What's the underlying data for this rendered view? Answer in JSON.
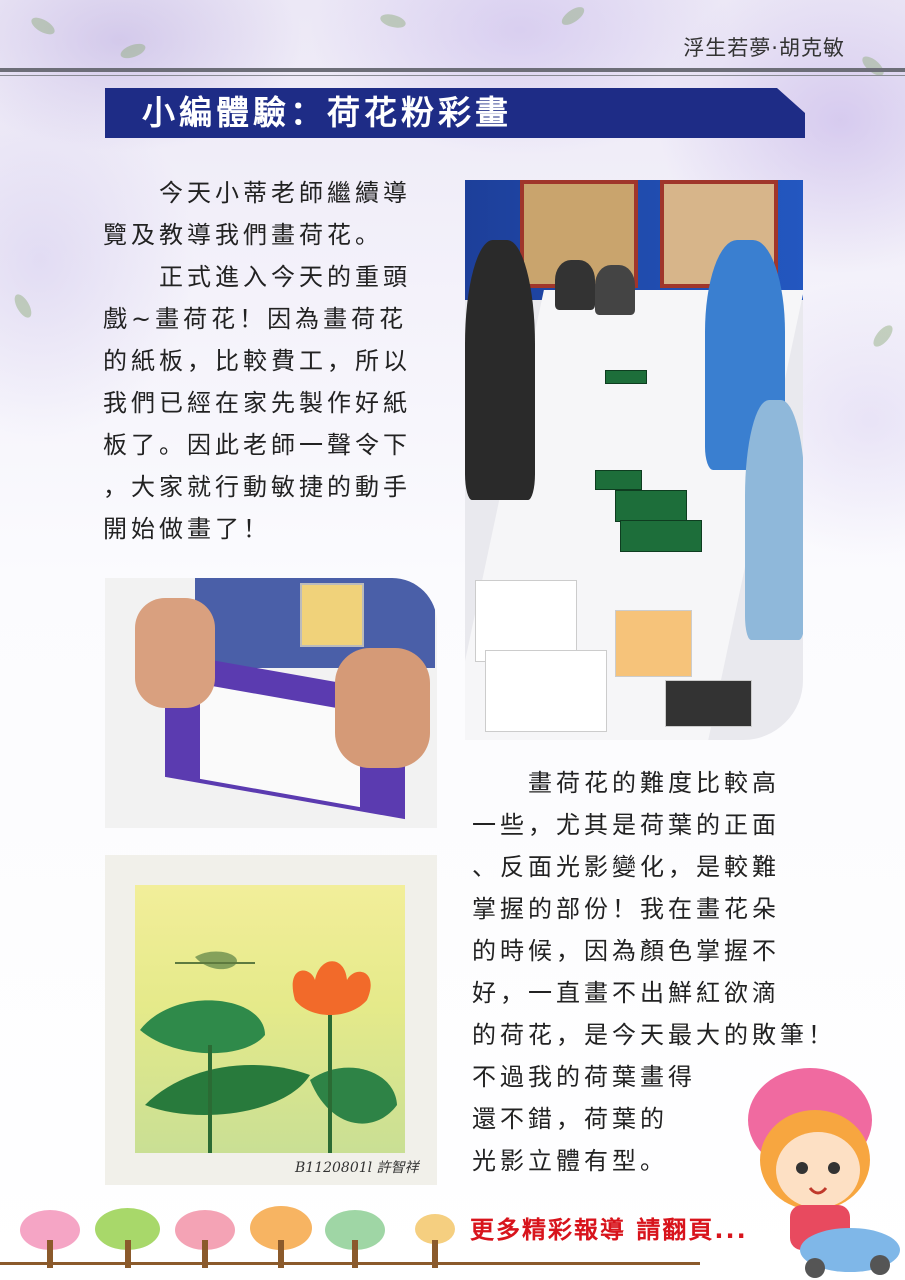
{
  "header": {
    "author": "浮生若夢·胡克敏",
    "title": "小編體驗：荷花粉彩畫"
  },
  "article": {
    "paragraph1": "　　今天小蒂老師繼續導\n覽及教導我們畫荷花。\n　　正式進入今天的重頭\n戲~畫荷花！因為畫荷花\n的紙板，比較費工，所以\n我們已經在家先製作好紙\n板了。因此老師一聲令下\n，大家就行動敏捷的動手\n開始做畫了！",
    "paragraph2": "　　畫荷花的難度比較高\n一些，尤其是荷葉的正面\n、反面光影變化，是較難\n掌握的部份！我在畫花朵\n的時候，因為顏色掌握不\n好，一直畫不出鮮紅欲滴\n的荷花，是今天最大的敗筆！\n不過我的荷葉畫得\n還不錯，荷葉的\n光影立體有型。"
  },
  "painting": {
    "signature": "B1120801l 許智祥"
  },
  "footer": {
    "more": "更多精彩報導 請翻頁..."
  },
  "colors": {
    "title_bar": "#1e2c86",
    "footer_text": "#d8141c"
  }
}
